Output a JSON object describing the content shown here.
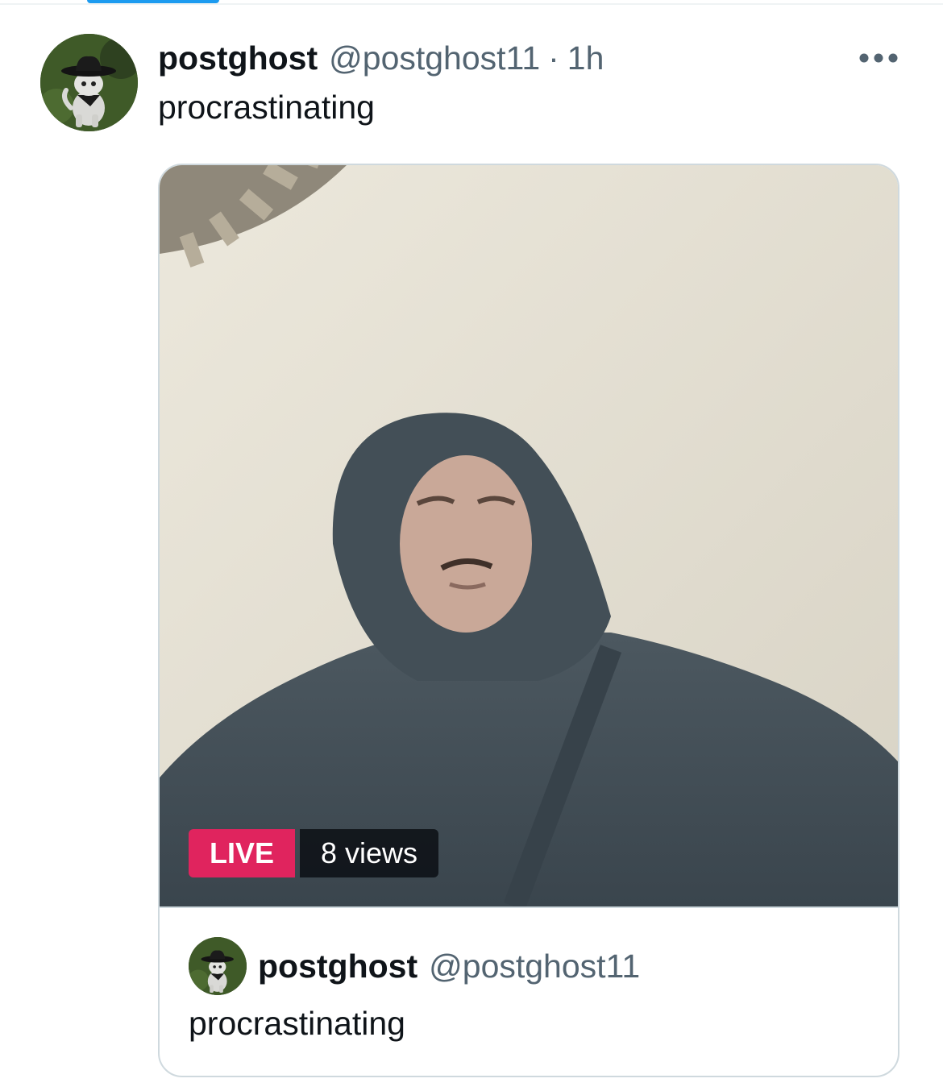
{
  "post": {
    "author": {
      "display_name": "postghost",
      "handle": "@postghost11"
    },
    "separator": "·",
    "timestamp": "1h",
    "text": "procrastinating",
    "more_icon": "ellipsis-icon"
  },
  "live_card": {
    "live_label": "LIVE",
    "views_label": "8 views",
    "host": {
      "display_name": "postghost",
      "handle": "@postghost11"
    },
    "title": "procrastinating"
  },
  "colors": {
    "accent": "#1d9bf0",
    "live_badge": "#e0245e",
    "secondary_text": "#536471",
    "border": "#cfd9de"
  }
}
